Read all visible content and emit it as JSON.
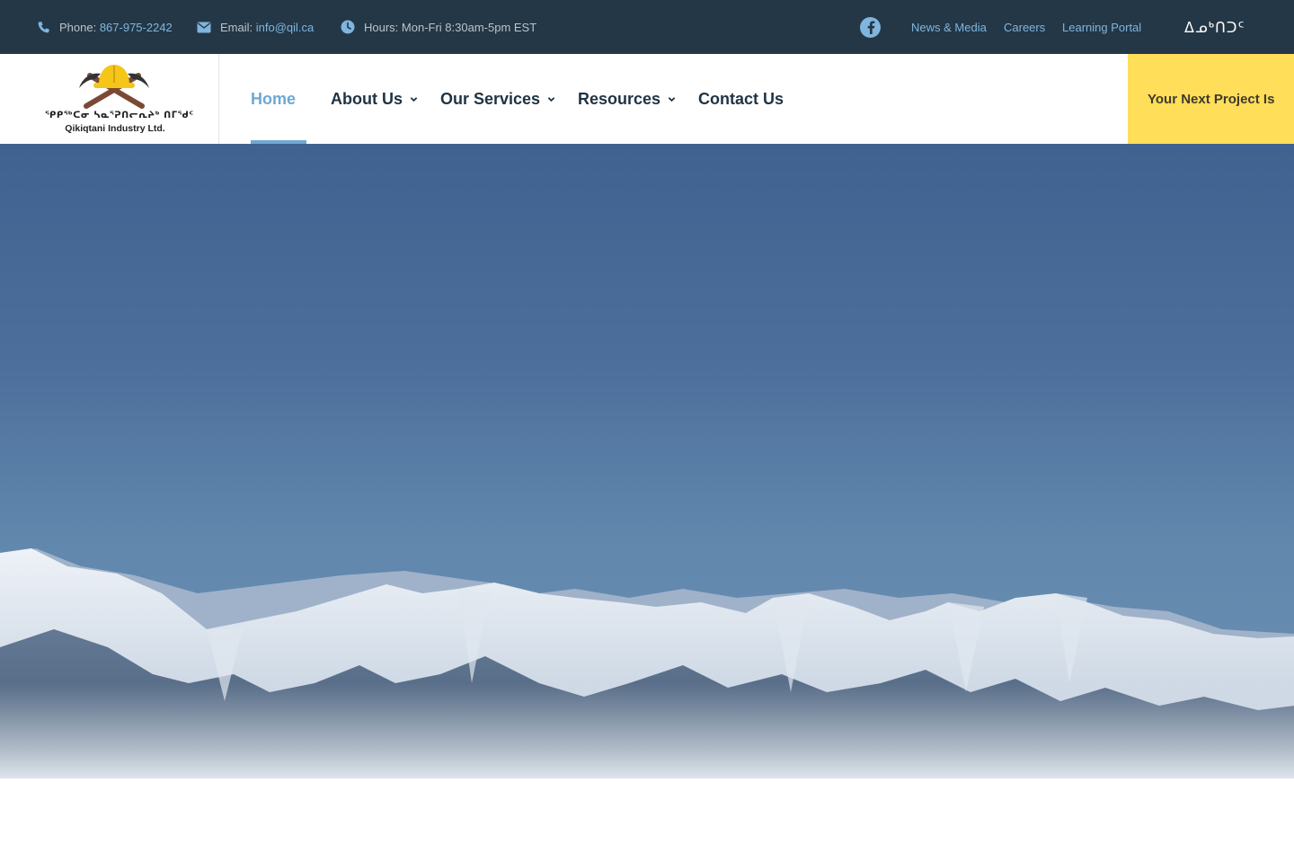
{
  "topbar": {
    "phone_label": "Phone:",
    "phone_value": "867-975-2242",
    "email_label": "Email:",
    "email_value": "info@qil.ca",
    "hours_text": "Hours: Mon-Fri 8:30am-5pm EST",
    "links": [
      "News & Media",
      "Careers",
      "Learning Portal"
    ],
    "language_toggle": "ᐃᓄᒃᑎᑐᑦ"
  },
  "logo": {
    "syllabics": "ᕿᑭᖅᑕᓂ ᓴᓇᕐᕈᑎᓕᕆᔨᒃ ᑎᒥᖁᑦ",
    "name": "Qikiqtani Industry Ltd."
  },
  "nav": {
    "items": [
      {
        "label": "Home",
        "active": true,
        "dropdown": false
      },
      {
        "label": "About Us",
        "active": false,
        "dropdown": true
      },
      {
        "label": "Our Services",
        "active": false,
        "dropdown": true
      },
      {
        "label": "Resources",
        "active": false,
        "dropdown": true
      },
      {
        "label": "Contact Us",
        "active": false,
        "dropdown": false
      }
    ],
    "cta_label": "Your Next Project Is"
  },
  "colors": {
    "topbar_bg": "#243746",
    "accent_blue": "#6ea8d3",
    "nav_text": "#1f3343",
    "cta_bg": "#ffde59"
  },
  "icons": {
    "phone": "phone-icon",
    "email": "envelope-icon",
    "hours": "clock-icon",
    "social": "facebook-icon",
    "logo": "hardhat-pickaxes-icon"
  }
}
